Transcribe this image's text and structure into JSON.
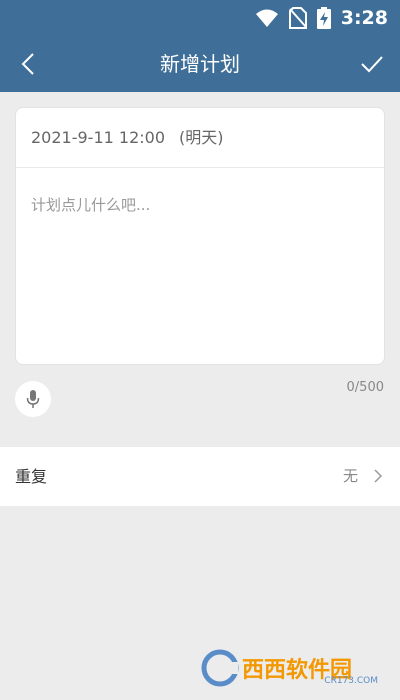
{
  "status_bar": {
    "time": "3:28",
    "icons": [
      "wifi-icon",
      "no-sim-icon",
      "battery-charging-icon"
    ]
  },
  "app_bar": {
    "title": "新增计划",
    "back_icon": "chevron-left-icon",
    "confirm_icon": "check-icon"
  },
  "plan": {
    "date": "2021-9-11 12:00",
    "day_label": "(明天)",
    "placeholder": "计划点儿什么吧...",
    "value": "",
    "char_count": "0/500"
  },
  "repeat": {
    "label": "重复",
    "value": "无"
  },
  "watermark": {
    "text": "西西软件园",
    "sub": "CR173.COM"
  },
  "colors": {
    "header": "#3f6f98",
    "background": "#ececec",
    "watermark": "#f39800"
  }
}
